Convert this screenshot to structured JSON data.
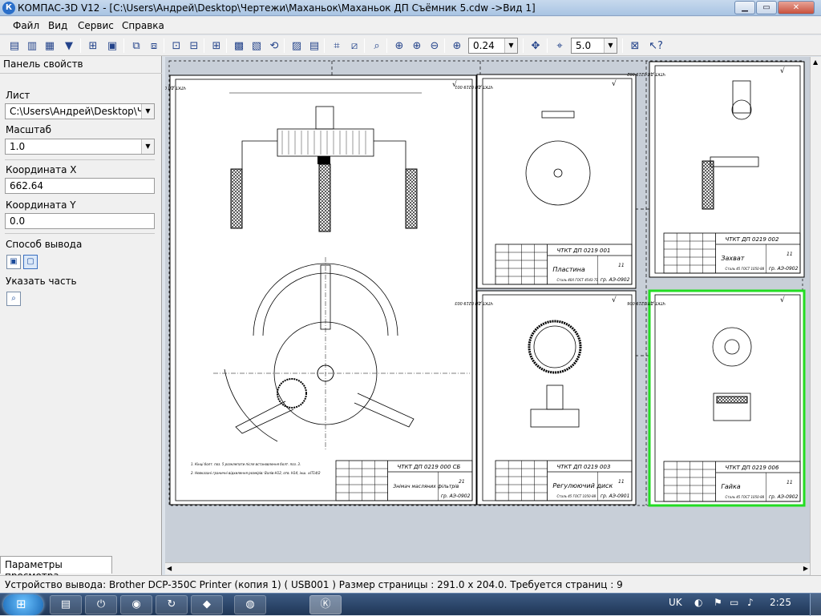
{
  "window": {
    "title": "КОМПАС-3D V12 - [C:\\Users\\Андрей\\Desktop\\Чертежи\\Маханьок\\Маханьок ДП Съёмник 5.cdw ->Вид 1]",
    "app_icon": "К"
  },
  "menu": [
    "Файл",
    "Вид",
    "Сервис",
    "Справка"
  ],
  "toolbar": {
    "scale_value": "0.24",
    "step_value": "5.0"
  },
  "panel": {
    "title": "Панель свойств",
    "sheet_label": "Лист",
    "sheet_value": "C:\\Users\\Андрей\\Desktop\\Че",
    "scale_label": "Масштаб",
    "scale_value": "1.0",
    "coord_x_label": "Координата X",
    "coord_x_value": "662.64",
    "coord_y_label": "Координата Y",
    "coord_y_value": "0.0",
    "output_label": "Способ вывода",
    "part_label": "Указать часть",
    "tab_label": "Параметры просмотра"
  },
  "sheets": [
    {
      "stamp": "ЧТКТ ДП 0219 000 СБ",
      "name": "Знімач масляних фільтрів",
      "group": "гр. АЭ-0902",
      "sheet": "21",
      "topcode": "ЧТКТ ДП 0219 000 СБ",
      "notes": [
        "1. Кінці болт. поз. 5 розклепати після встановлення болт. поз. 3.",
        "2. Невказані граничні відхилення розмірів: Валів-Н12, отв. Н14, інш. ±IT14/2"
      ]
    },
    {
      "stamp": "ЧТКТ ДП 0219 001",
      "name": "Пластина",
      "group": "гр. АЭ-0902",
      "sheet": "11",
      "material": "Сталь 40Х ГОСТ 4543-71",
      "topcode": "ЧТКТ ДП 0219 001"
    },
    {
      "stamp": "ЧТКТ ДП 0219 002",
      "name": "Захват",
      "group": "гр. АЭ-0902",
      "sheet": "11",
      "material": "Сталь 45 ГОСТ 1050-88",
      "topcode": "ЧТКТ ДП 0219 002"
    },
    {
      "stamp": "ЧТКТ ДП 0219 003",
      "name": "Регулюючий диск",
      "group": "гр. АЭ-0901",
      "sheet": "11",
      "material": "Сталь 45 ГОСТ 1050-88",
      "topcode": "ЧТКТ ДП 0219 003"
    },
    {
      "stamp": "ЧТКТ ДП 0219 006",
      "name": "Гайка",
      "group": "гр. АЭ-0902",
      "sheet": "11",
      "material": "Сталь 45 ГОСТ 1050-88",
      "topcode": "ЧТКТ ДП 0219 006"
    }
  ],
  "status": {
    "text": "Устройство вывода: Brother DCP-350C Printer (копия 1) ( USB001 )  Размер страницы : 291.0 x 204.0.  Требуется страниц : 9"
  },
  "taskbar": {
    "lang": "UK",
    "time": "2:25",
    "apps": [
      "explorer-icon",
      "power-icon",
      "chrome-icon",
      "update-icon",
      "app-icon",
      "firefox-icon",
      "kompas-icon"
    ]
  },
  "colors": {
    "selected_sheet": "#22dd22",
    "title_bar": "#bcd2ea",
    "taskbar": "#2a4a70"
  }
}
